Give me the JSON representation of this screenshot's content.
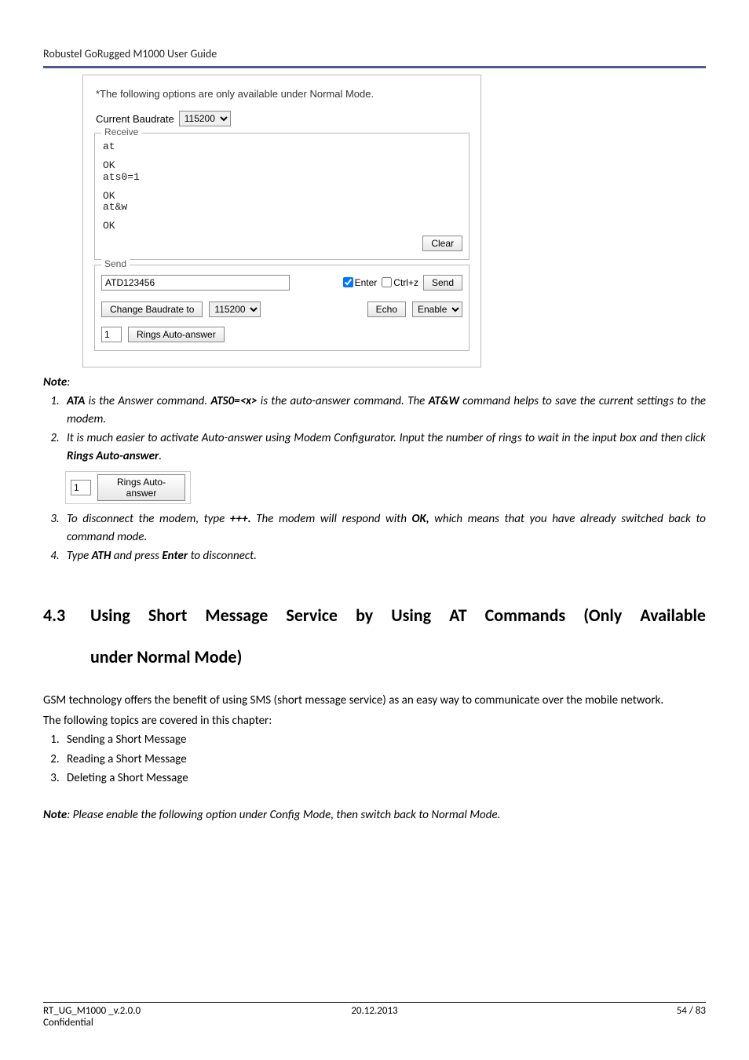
{
  "header": {
    "title": "Robustel GoRugged M1000 User Guide"
  },
  "screenshot": {
    "top_note": "*The following options are only available under Normal Mode.",
    "current_baudrate_label": "Current Baudrate",
    "current_baudrate_value": "115200",
    "receive": {
      "legend": "Receive",
      "lines": [
        "at",
        "OK",
        "ats0=1",
        "OK",
        "at&w",
        "OK"
      ],
      "clear_label": "Clear"
    },
    "send": {
      "legend": "Send",
      "input_value": "ATD123456",
      "enter_label": "Enter",
      "ctrlz_label": "Ctrl+z",
      "send_btn": "Send",
      "change_baud_btn": "Change Baudrate to",
      "change_baud_value": "115200",
      "echo_btn": "Echo",
      "echo_value": "Enable",
      "rings_value": "1",
      "rings_btn": "Rings Auto-answer"
    }
  },
  "notes": {
    "label": "Note",
    "colon": ":",
    "items": [
      "<b>ATA</b> is the Answer command. <b>ATS0=&lt;x&gt;</b> is the auto-answer command. The <b>AT&amp;W</b> command helps to save the current settings to the modem.",
      "It is much easier to activate Auto-answer using Modem Configurator. Input the number of rings to wait in the input box and then click <b>Rings Auto-answer</b>.",
      "To disconnect the modem, type <b>+++.</b> The modem will respond with <b>OK,</b> which means that you have already switched back to command mode.",
      "Type <b>ATH</b> and press <b>Enter</b> to disconnect."
    ]
  },
  "inline_snippet": {
    "value": "1",
    "btn": "Rings Auto-answer"
  },
  "section": {
    "number": "4.3",
    "title_line1": "Using Short Message Service by Using AT Commands (Only Available",
    "title_line2": "under Normal Mode)"
  },
  "body": {
    "p1": "GSM technology offers the benefit of using SMS (short message service) as an easy way to communicate over the mobile network.",
    "p2": "The following topics are covered in this chapter:",
    "list": [
      "Sending a Short Message",
      "Reading a Short Message",
      "Deleting a Short Message"
    ],
    "note_final": ": Please enable the following option under Config Mode, then switch back to Normal Mode."
  },
  "footer": {
    "left": "RT_UG_M1000 _v.2.0.0",
    "center": "20.12.2013",
    "right": "54 / 83",
    "confidential": "Confidential"
  }
}
